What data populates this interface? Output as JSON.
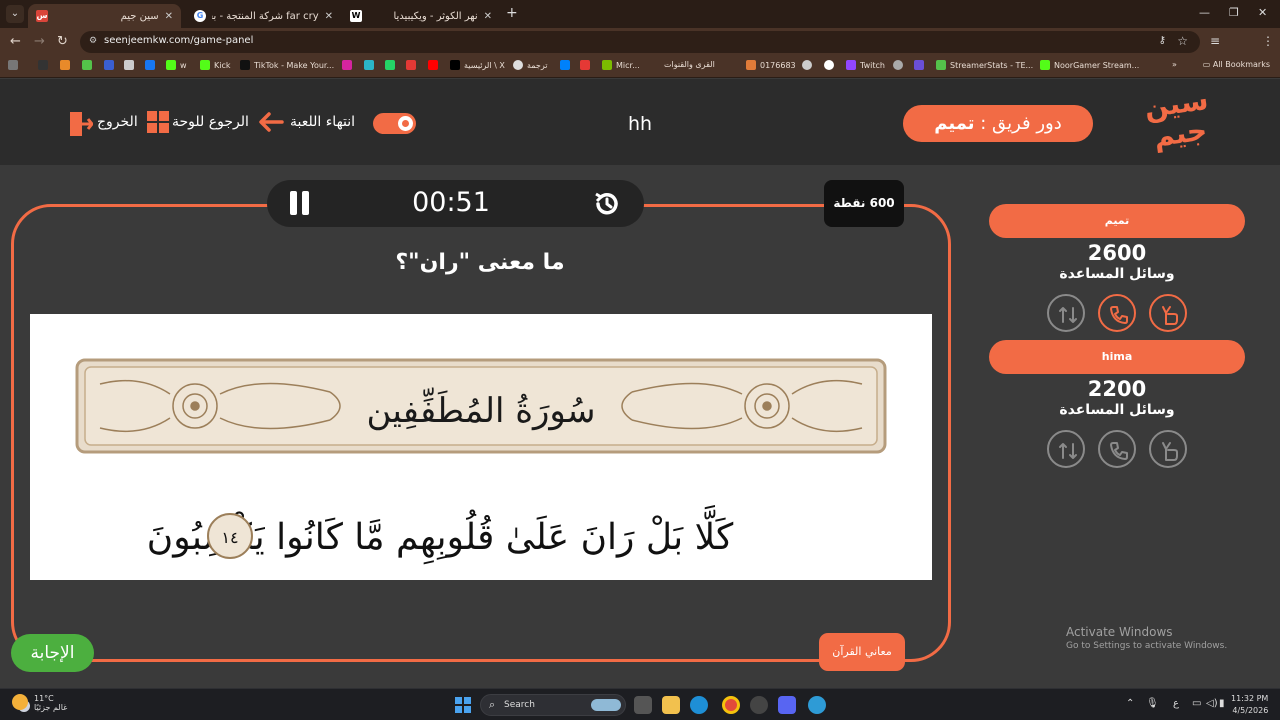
{
  "browser": {
    "tabs": [
      {
        "title": "سين جيم",
        "active": true
      },
      {
        "title": "far cry شركة المنتجة - بحث Google",
        "active": false
      },
      {
        "title": "نهر الكوثر - ويكيبيديا",
        "active": false
      }
    ],
    "url": "seenjeemkw.com/game-panel",
    "bookmarks": [
      "w",
      "Kick",
      "TikTok - Make Your...",
      "الرئيسية \\ X",
      "ترجمة",
      "Micr...",
      "القرى والقنوات",
      "0176683",
      "Twitch",
      "StreamerStats - TE...",
      "NoorGamer Stream..."
    ],
    "all_bookmarks": "All Bookmarks"
  },
  "header": {
    "logo_text": "سين جيم",
    "turn_prefix": "دور فريق : ",
    "turn_team": "تميم",
    "game_name": "hh",
    "end_game": "انتهاء اللعبة",
    "back_to_board": "الرجوع للوحة",
    "exit": "الخروج"
  },
  "question_panel": {
    "timer": "00:51",
    "points": "600 نقطة",
    "question": "ما معنى \"ران\"؟",
    "image_title": "سُورَةُ المُطَفِّفِين",
    "image_verse": "كَلَّا بَلْ رَانَ عَلَىٰ قُلُوبِهِم مَّا كَانُوا يَكْسِبُونَ",
    "image_verse_number": "١٤",
    "answer_button": "الإجابة",
    "category": "معاني القرآن"
  },
  "teams": [
    {
      "name": "تميم",
      "score": "2600",
      "aids_label": "وسائل المساعدة",
      "aids": [
        {
          "icon": "two-answers-icon",
          "active": true
        },
        {
          "icon": "phone-icon",
          "active": true
        },
        {
          "icon": "swap-icon",
          "active": false
        }
      ]
    },
    {
      "name": "hima",
      "score": "2200",
      "aids_label": "وسائل المساعدة",
      "aids": [
        {
          "icon": "two-answers-icon",
          "active": false
        },
        {
          "icon": "phone-icon",
          "active": false
        },
        {
          "icon": "swap-icon",
          "active": false
        }
      ]
    }
  ],
  "watermark": {
    "line1": "Activate Windows",
    "line2": "Go to Settings to activate Windows."
  },
  "taskbar": {
    "weather_temp": "11°C",
    "weather_desc": "غالم جزئيًا",
    "search": "Search",
    "time": "11:32 PM",
    "date": "4/5/2026",
    "lang": "ع"
  },
  "colors": {
    "accent": "#f26b45",
    "answer": "#4caf3f",
    "background": "#3a3a3a",
    "header": "#2c2c2c"
  }
}
